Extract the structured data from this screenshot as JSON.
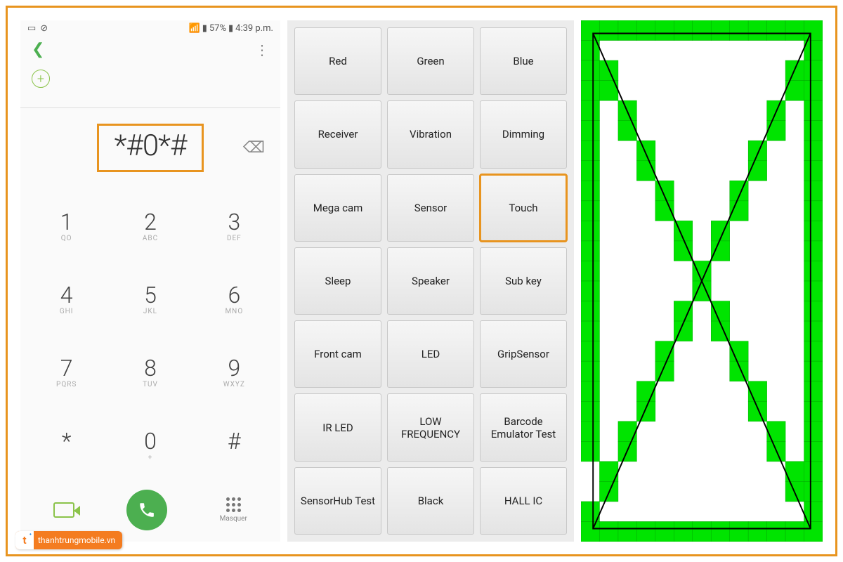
{
  "colors": {
    "accent_orange": "#e8941f",
    "accent_green": "#4caf50",
    "touch_green": "#00e400"
  },
  "statusbar": {
    "signal_pct": "57%",
    "time": "4:39 p.m."
  },
  "dialer": {
    "code": "*#0*#",
    "keys": [
      {
        "d": "1",
        "s": "QO"
      },
      {
        "d": "2",
        "s": "ABC"
      },
      {
        "d": "3",
        "s": "DEF"
      },
      {
        "d": "4",
        "s": "GHI"
      },
      {
        "d": "5",
        "s": "JKL"
      },
      {
        "d": "6",
        "s": "MNO"
      },
      {
        "d": "7",
        "s": "PQRS"
      },
      {
        "d": "8",
        "s": "TUV"
      },
      {
        "d": "9",
        "s": "WXYZ"
      },
      {
        "d": "*",
        "s": ""
      },
      {
        "d": "0",
        "s": "+"
      },
      {
        "d": "#",
        "s": ""
      }
    ],
    "masquer_label": "Masquer"
  },
  "test_menu": {
    "buttons": [
      "Red",
      "Green",
      "Blue",
      "Receiver",
      "Vibration",
      "Dimming",
      "Mega cam",
      "Sensor",
      "Touch",
      "Sleep",
      "Speaker",
      "Sub key",
      "Front cam",
      "LED",
      "GripSensor",
      "IR LED",
      "LOW FREQUENCY",
      "Barcode Emulator Test",
      "SensorHub Test",
      "Black",
      "HALL IC"
    ],
    "highlighted_index": 8
  },
  "watermark": {
    "logo_letter": "t",
    "text": "thanhtrungmobile.vn"
  }
}
